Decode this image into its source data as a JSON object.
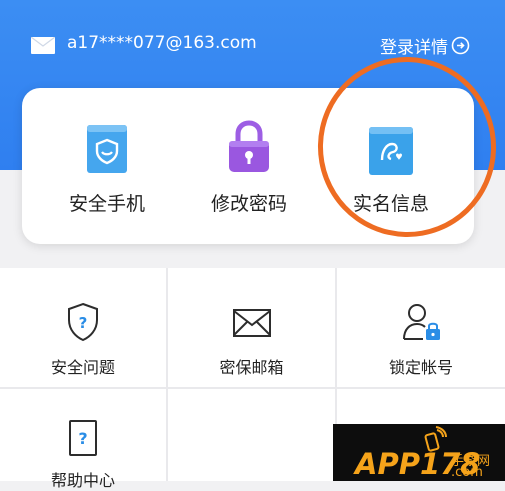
{
  "header": {
    "email": "a17****077@163.com",
    "login_detail": "登录详情"
  },
  "card": {
    "items": [
      {
        "label": "安全手机",
        "icon": "shield-phone-icon"
      },
      {
        "label": "修改密码",
        "icon": "lock-icon"
      },
      {
        "label": "实名信息",
        "icon": "id-card-icon"
      }
    ]
  },
  "grid": {
    "items": [
      {
        "label": "安全问题",
        "icon": "question-shield-icon"
      },
      {
        "label": "密保邮箱",
        "icon": "envelope-icon"
      },
      {
        "label": "锁定帐号",
        "icon": "user-lock-icon"
      },
      {
        "label": "帮助中心",
        "icon": "help-doc-icon"
      }
    ]
  },
  "watermark": {
    "main": "APP178",
    "sub": "手游网",
    "com": ".com"
  },
  "colors": {
    "header_blue": "#2f7ff0",
    "annotation_orange": "#ee6c22",
    "icon_blue": "#3aa2ea",
    "icon_purple": "#9a57e0"
  }
}
